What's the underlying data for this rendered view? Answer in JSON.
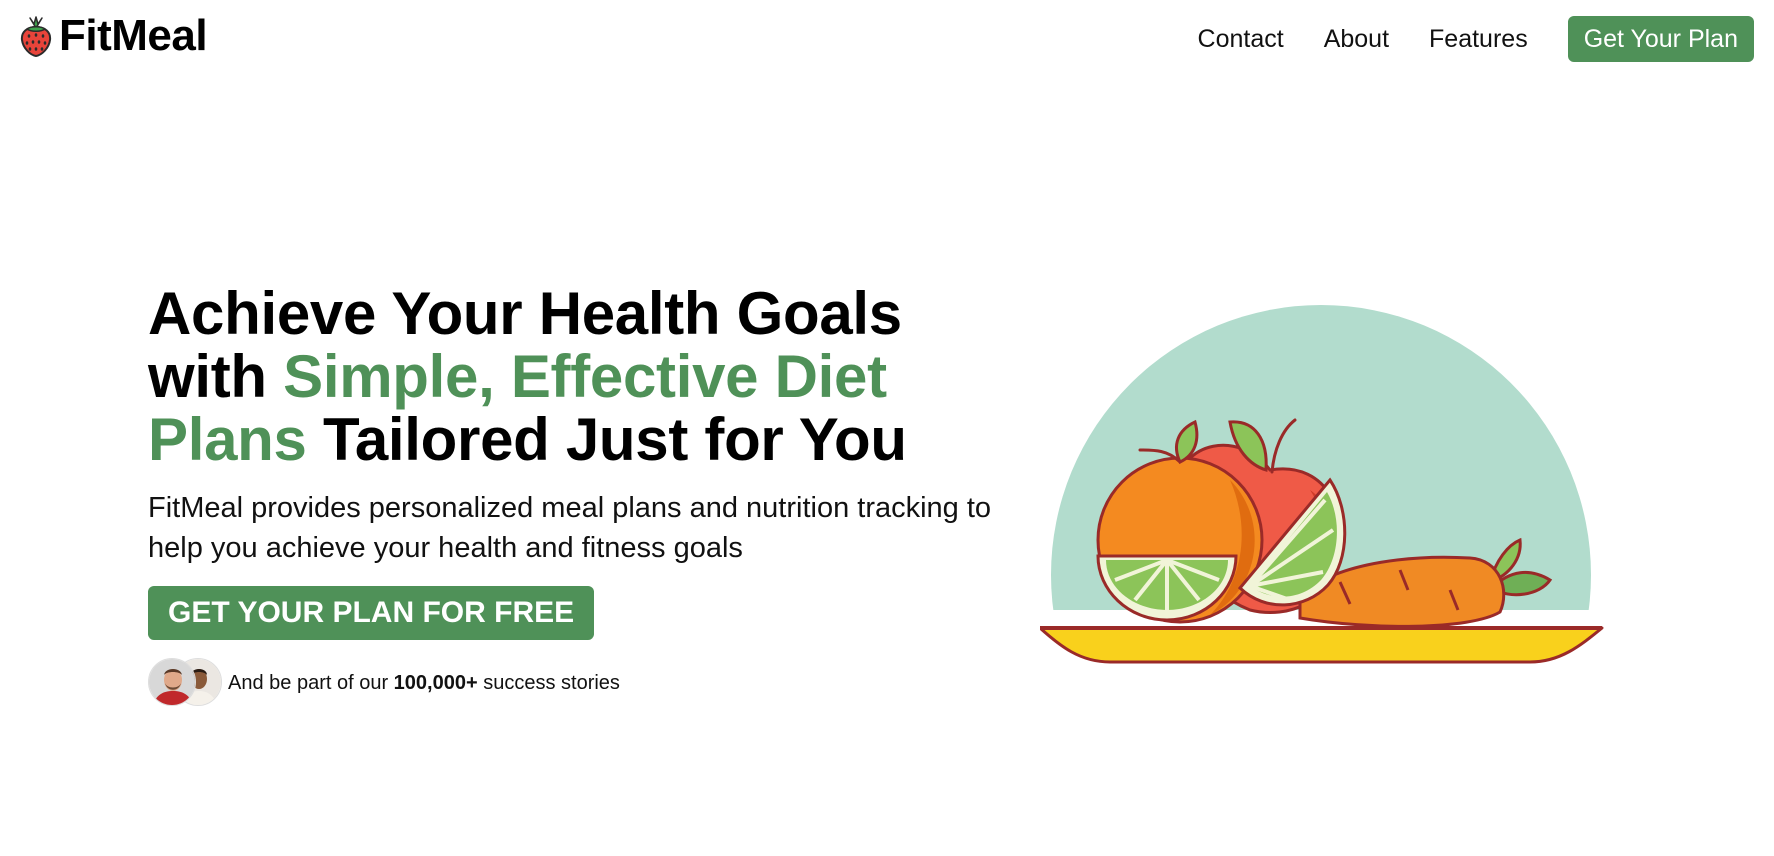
{
  "nav": {
    "brand": "FitMeal",
    "links": [
      "Contact",
      "About",
      "Features"
    ],
    "cta": "Get Your Plan"
  },
  "hero": {
    "title_part1": "Achieve Your Health Goals with ",
    "title_highlight": "Simple, Effective Diet Plans",
    "title_part2": " Tailored Just for You",
    "subtitle": "FitMeal provides personalized meal plans and nutrition tracking to help you achieve your health and fitness goals",
    "cta": "GET YOUR PLAN FOR FREE",
    "proof_prefix": "And be part of our ",
    "proof_count": "100,000+",
    "proof_suffix": " success stories"
  },
  "colors": {
    "accent": "#4f9158",
    "illustration_bg": "#b2dccd",
    "plate": "#f9d11c"
  },
  "icons": {
    "logo": "strawberry-icon",
    "illustration": "fruit-plate-illustration"
  }
}
